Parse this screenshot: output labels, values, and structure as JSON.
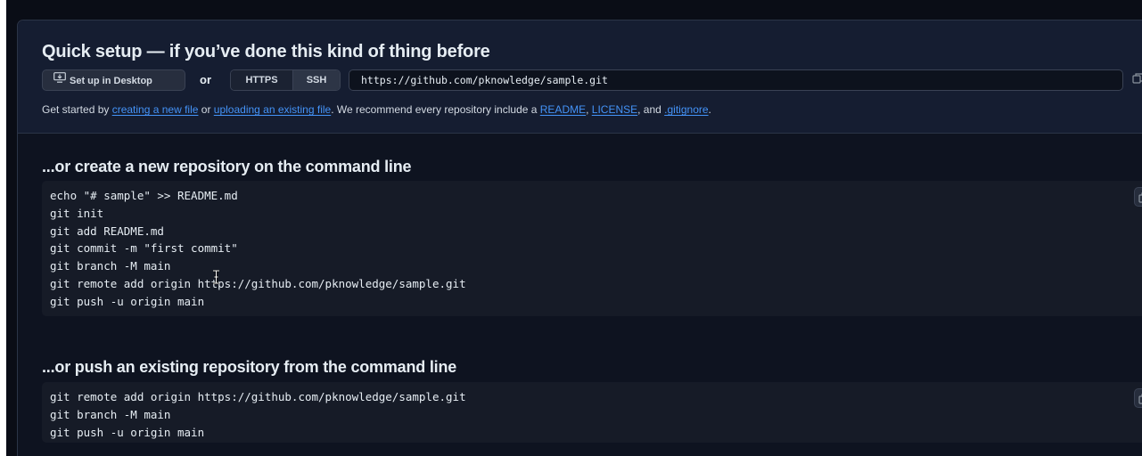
{
  "quick_setup": {
    "title": "Quick setup — if you’ve done this kind of thing before",
    "desktop_button": "Set up in Desktop",
    "or": "or",
    "protocols": [
      "HTTPS",
      "SSH"
    ],
    "selected_protocol": "SSH",
    "clone_url": "https://github.com/pknowledge/sample.git",
    "hint": {
      "t1": "Get started by ",
      "link1": "creating a new file",
      "t2": " or ",
      "link2": "uploading an existing file",
      "t3": ". We recommend every repository include a ",
      "link3": "README",
      "t4": ", ",
      "link4": "LICENSE",
      "t5": ", and ",
      "link5": ".gitignore",
      "t6": "."
    }
  },
  "new_repo": {
    "title": "...or create a new repository on the command line",
    "lines": [
      "echo \"# sample\" >> README.md",
      "git init",
      "git add README.md",
      "git commit -m \"first commit\"",
      "git branch -M main",
      "git remote add origin https://github.com/pknowledge/sample.git",
      "git push -u origin main"
    ]
  },
  "push_repo": {
    "title": "...or push an existing repository from the command line",
    "lines": [
      "git remote add origin https://github.com/pknowledge/sample.git",
      "git branch -M main",
      "git push -u origin main"
    ]
  },
  "icons": {
    "desktop": "desktop-download-icon",
    "copy": "copy-icon",
    "cursor": "text-cursor-icon"
  },
  "colors": {
    "background": "#0a0d16",
    "panel": "#0e1320",
    "quick_setup_bg": "#151d31",
    "code_bg": "#161b27",
    "link": "#4493f8",
    "text": "#e6edf3"
  }
}
